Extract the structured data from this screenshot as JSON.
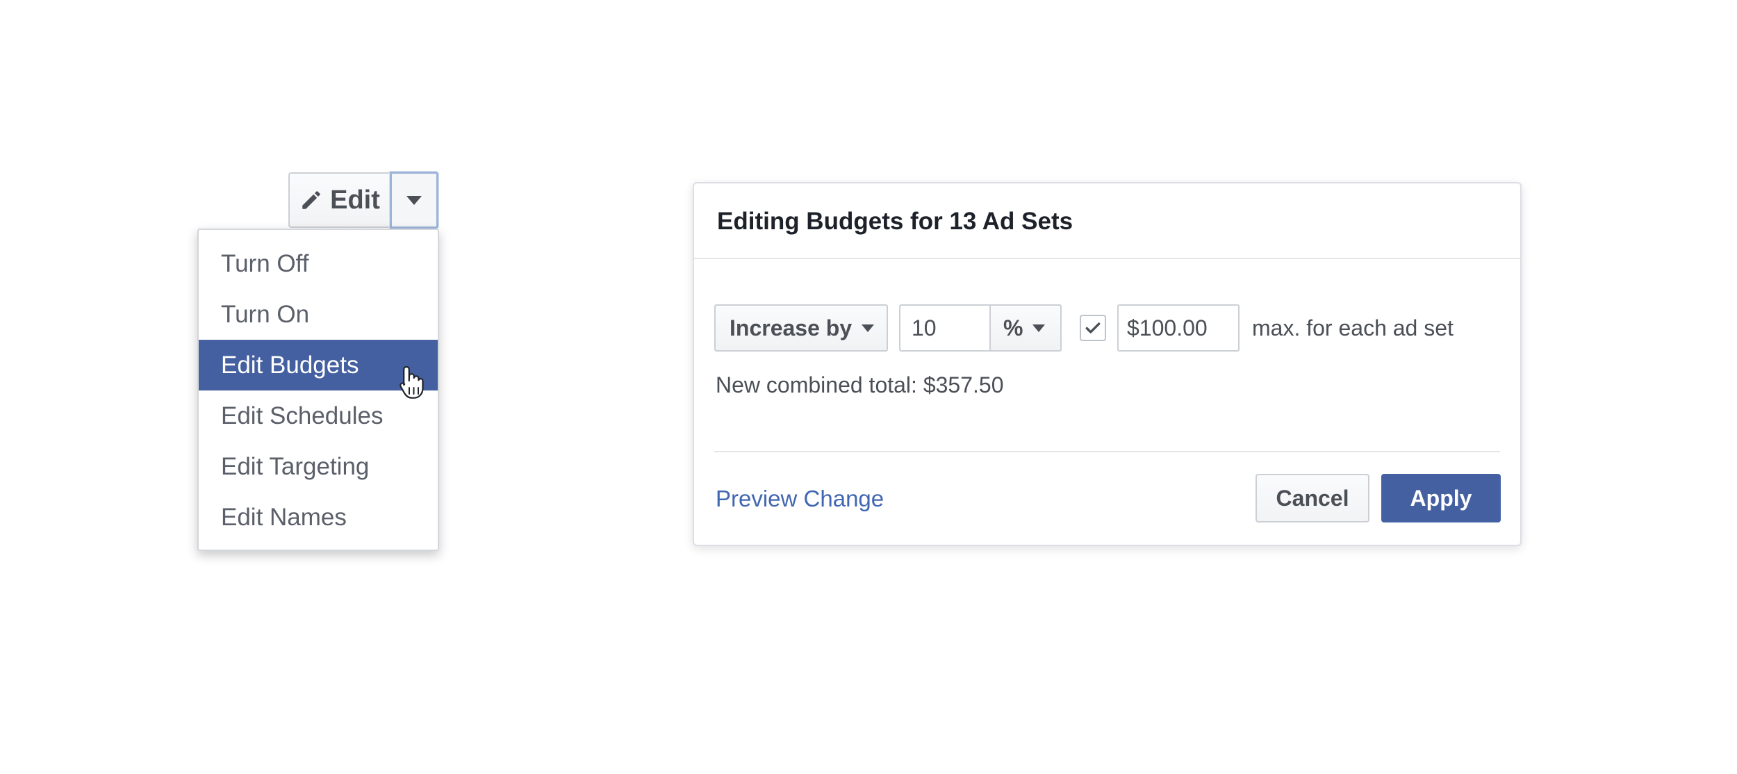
{
  "edit_button": {
    "label": "Edit",
    "icon": "pencil-icon"
  },
  "menu": {
    "items": [
      {
        "label": "Turn Off"
      },
      {
        "label": "Turn On"
      },
      {
        "label": "Edit Budgets",
        "active": true
      },
      {
        "label": "Edit Schedules"
      },
      {
        "label": "Edit Targeting"
      },
      {
        "label": "Edit Names"
      }
    ]
  },
  "dialog": {
    "title": "Editing Budgets for 13 Ad Sets",
    "mode_dropdown": "Increase by",
    "amount_value": "10",
    "unit_dropdown": "%",
    "cap_checked": true,
    "cap_value": "$100.00",
    "cap_label": "max. for each ad set",
    "total_text": "New combined total: $357.50",
    "preview_link": "Preview Change",
    "cancel_label": "Cancel",
    "apply_label": "Apply"
  },
  "colors": {
    "accent": "#4460a0",
    "link": "#4267b2",
    "text": "#4b4f56"
  }
}
